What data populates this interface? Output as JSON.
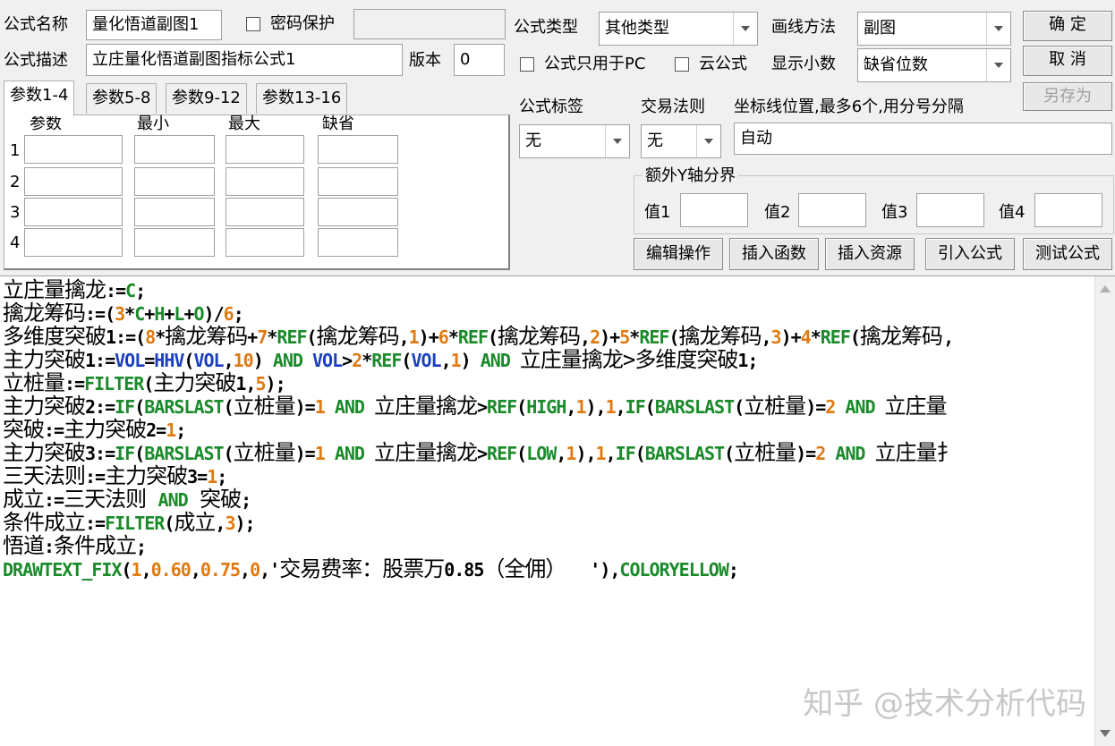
{
  "form": {
    "name_label": "公式名称",
    "name_value": "量化悟道副图1",
    "password_label": "密码保护",
    "desc_label": "公式描述",
    "desc_value": "立庄量化悟道副图指标公式1",
    "version_label": "版本",
    "version_value": "0",
    "type_label": "公式类型",
    "type_value": "其他类型",
    "draw_label": "画线方法",
    "draw_value": "副图",
    "pc_only_label": "公式只用于PC",
    "cloud_label": "云公式",
    "decimal_label": "显示小数",
    "decimal_value": "缺省位数",
    "tag_label": "公式标签",
    "tag_value": "无",
    "trade_label": "交易法则",
    "trade_value": "无",
    "coord_label": "坐标线位置,最多6个,用分号分隔",
    "coord_value": "自动",
    "yaxis_group": "额外Y轴分界",
    "yaxis_values": [
      "值1",
      "值2",
      "值3",
      "值4"
    ]
  },
  "buttons": {
    "ok": "确 定",
    "cancel": "取 消",
    "save_as": "另存为",
    "edit_ops": "编辑操作",
    "insert_func": "插入函数",
    "insert_res": "插入资源",
    "import_formula": "引入公式",
    "test_formula": "测试公式"
  },
  "param_tabs": [
    "参数1-4",
    "参数5-8",
    "参数9-12",
    "参数13-16"
  ],
  "param_headers": [
    "参数",
    "最小",
    "最大",
    "缺省"
  ],
  "param_rows": [
    "1",
    "2",
    "3",
    "4"
  ],
  "code_lines": [
    [
      [
        "t",
        "立庄量擒龙"
      ],
      [
        "o",
        ":="
      ],
      [
        "k",
        "C"
      ],
      [
        "o",
        ";"
      ]
    ],
    [
      [
        "t",
        "擒龙筹码"
      ],
      [
        "o",
        ":=("
      ],
      [
        "n",
        "3"
      ],
      [
        "o",
        "*"
      ],
      [
        "k",
        "C"
      ],
      [
        "o",
        "+"
      ],
      [
        "k",
        "H"
      ],
      [
        "o",
        "+"
      ],
      [
        "k",
        "L"
      ],
      [
        "o",
        "+"
      ],
      [
        "k",
        "O"
      ],
      [
        "o",
        ")/"
      ],
      [
        "n",
        "6"
      ],
      [
        "o",
        ";"
      ]
    ],
    [
      [
        "t",
        "多维度突破"
      ],
      [
        "o",
        "1:=("
      ],
      [
        "n",
        "8"
      ],
      [
        "o",
        "*"
      ],
      [
        "t",
        "擒龙筹码"
      ],
      [
        "o",
        "+"
      ],
      [
        "n",
        "7"
      ],
      [
        "o",
        "*"
      ],
      [
        "k",
        "REF"
      ],
      [
        "o",
        "("
      ],
      [
        "t",
        "擒龙筹码"
      ],
      [
        "o",
        ","
      ],
      [
        "n",
        "1"
      ],
      [
        "o",
        ")+"
      ],
      [
        "n",
        "6"
      ],
      [
        "o",
        "*"
      ],
      [
        "k",
        "REF"
      ],
      [
        "o",
        "("
      ],
      [
        "t",
        "擒龙筹码"
      ],
      [
        "o",
        ","
      ],
      [
        "n",
        "2"
      ],
      [
        "o",
        ")+"
      ],
      [
        "n",
        "5"
      ],
      [
        "o",
        "*"
      ],
      [
        "k",
        "REF"
      ],
      [
        "o",
        "("
      ],
      [
        "t",
        "擒龙筹码"
      ],
      [
        "o",
        ","
      ],
      [
        "n",
        "3"
      ],
      [
        "o",
        ")+"
      ],
      [
        "n",
        "4"
      ],
      [
        "o",
        "*"
      ],
      [
        "k",
        "REF"
      ],
      [
        "o",
        "("
      ],
      [
        "t",
        "擒龙筹码,"
      ]
    ],
    [
      [
        "t",
        "主力突破"
      ],
      [
        "o",
        "1:="
      ],
      [
        "b",
        "VOL"
      ],
      [
        "o",
        "="
      ],
      [
        "b",
        "HHV"
      ],
      [
        "o",
        "("
      ],
      [
        "b",
        "VOL"
      ],
      [
        "o",
        ","
      ],
      [
        "n",
        "10"
      ],
      [
        "o",
        ") "
      ],
      [
        "k",
        "AND"
      ],
      [
        "o",
        " "
      ],
      [
        "b",
        "VOL"
      ],
      [
        "o",
        ">"
      ],
      [
        "n",
        "2"
      ],
      [
        "o",
        "*"
      ],
      [
        "k",
        "REF"
      ],
      [
        "o",
        "("
      ],
      [
        "b",
        "VOL"
      ],
      [
        "o",
        ","
      ],
      [
        "n",
        "1"
      ],
      [
        "o",
        ") "
      ],
      [
        "k",
        "AND"
      ],
      [
        "o",
        " "
      ],
      [
        "t",
        "立庄量擒龙>多维度突破"
      ],
      [
        "o",
        "1;"
      ]
    ],
    [
      [
        "t",
        "立桩量"
      ],
      [
        "o",
        ":="
      ],
      [
        "k",
        "FILTER"
      ],
      [
        "o",
        "("
      ],
      [
        "t",
        "主力突破"
      ],
      [
        "o",
        "1,"
      ],
      [
        "n",
        "5"
      ],
      [
        "o",
        ");"
      ]
    ],
    [
      [
        "t",
        "主力突破"
      ],
      [
        "o",
        "2:="
      ],
      [
        "k",
        "IF"
      ],
      [
        "o",
        "("
      ],
      [
        "k",
        "BARSLAST"
      ],
      [
        "o",
        "("
      ],
      [
        "t",
        "立桩量"
      ],
      [
        "o",
        ")="
      ],
      [
        "n",
        "1"
      ],
      [
        "o",
        " "
      ],
      [
        "k",
        "AND"
      ],
      [
        "o",
        " "
      ],
      [
        "t",
        "立庄量擒龙"
      ],
      [
        "o",
        ">"
      ],
      [
        "k",
        "REF"
      ],
      [
        "o",
        "("
      ],
      [
        "k",
        "HIGH"
      ],
      [
        "o",
        ","
      ],
      [
        "n",
        "1"
      ],
      [
        "o",
        "),"
      ],
      [
        "n",
        "1"
      ],
      [
        "o",
        ","
      ],
      [
        "k",
        "IF"
      ],
      [
        "o",
        "("
      ],
      [
        "k",
        "BARSLAST"
      ],
      [
        "o",
        "("
      ],
      [
        "t",
        "立桩量"
      ],
      [
        "o",
        ")="
      ],
      [
        "n",
        "2"
      ],
      [
        "o",
        " "
      ],
      [
        "k",
        "AND"
      ],
      [
        "o",
        " "
      ],
      [
        "t",
        "立庄量"
      ]
    ],
    [
      [
        "t",
        "突破"
      ],
      [
        "o",
        ":="
      ],
      [
        "t",
        "主力突破"
      ],
      [
        "o",
        "2="
      ],
      [
        "n",
        "1"
      ],
      [
        "o",
        ";"
      ]
    ],
    [
      [
        "t",
        "主力突破"
      ],
      [
        "o",
        "3:="
      ],
      [
        "k",
        "IF"
      ],
      [
        "o",
        "("
      ],
      [
        "k",
        "BARSLAST"
      ],
      [
        "o",
        "("
      ],
      [
        "t",
        "立桩量"
      ],
      [
        "o",
        ")="
      ],
      [
        "n",
        "1"
      ],
      [
        "o",
        " "
      ],
      [
        "k",
        "AND"
      ],
      [
        "o",
        " "
      ],
      [
        "t",
        "立庄量擒龙"
      ],
      [
        "o",
        ">"
      ],
      [
        "k",
        "REF"
      ],
      [
        "o",
        "("
      ],
      [
        "k",
        "LOW"
      ],
      [
        "o",
        ","
      ],
      [
        "n",
        "1"
      ],
      [
        "o",
        "),"
      ],
      [
        "n",
        "1"
      ],
      [
        "o",
        ","
      ],
      [
        "k",
        "IF"
      ],
      [
        "o",
        "("
      ],
      [
        "k",
        "BARSLAST"
      ],
      [
        "o",
        "("
      ],
      [
        "t",
        "立桩量"
      ],
      [
        "o",
        ")="
      ],
      [
        "n",
        "2"
      ],
      [
        "o",
        " "
      ],
      [
        "k",
        "AND"
      ],
      [
        "o",
        " "
      ],
      [
        "t",
        "立庄量扌"
      ]
    ],
    [
      [
        "t",
        "三天法则"
      ],
      [
        "o",
        ":="
      ],
      [
        "t",
        "主力突破"
      ],
      [
        "o",
        "3="
      ],
      [
        "n",
        "1"
      ],
      [
        "o",
        ";"
      ]
    ],
    [
      [
        "t",
        "成立"
      ],
      [
        "o",
        ":="
      ],
      [
        "t",
        "三天法则 "
      ],
      [
        "k",
        "AND"
      ],
      [
        "t",
        " 突破"
      ],
      [
        "o",
        ";"
      ]
    ],
    [
      [
        "t",
        "条件成立"
      ],
      [
        "o",
        ":="
      ],
      [
        "k",
        "FILTER"
      ],
      [
        "o",
        "("
      ],
      [
        "t",
        "成立"
      ],
      [
        "o",
        ","
      ],
      [
        "n",
        "3"
      ],
      [
        "o",
        ");"
      ]
    ],
    [
      [
        "t",
        "悟道"
      ],
      [
        "o",
        ":"
      ],
      [
        "t",
        "条件成立"
      ],
      [
        "o",
        ";"
      ]
    ],
    [
      [
        "k",
        "DRAWTEXT_FIX"
      ],
      [
        "o",
        "("
      ],
      [
        "n",
        "1"
      ],
      [
        "o",
        ","
      ],
      [
        "n",
        "0.60"
      ],
      [
        "o",
        ","
      ],
      [
        "n",
        "0.75"
      ],
      [
        "o",
        ","
      ],
      [
        "n",
        "0"
      ],
      [
        "o",
        ",'"
      ],
      [
        "t",
        "交易费率：股票万"
      ],
      [
        "o",
        "0.85"
      ],
      [
        "t",
        "（全佣）  "
      ],
      [
        "o",
        "'),"
      ],
      [
        "k",
        "COLORYELLOW"
      ],
      [
        "o",
        ";"
      ]
    ]
  ],
  "watermark": "知乎 @技术分析代码",
  "colors": {
    "keyword": "#1a8a2a",
    "number": "#e07a10",
    "blue_keyword": "#1b3fbf"
  }
}
